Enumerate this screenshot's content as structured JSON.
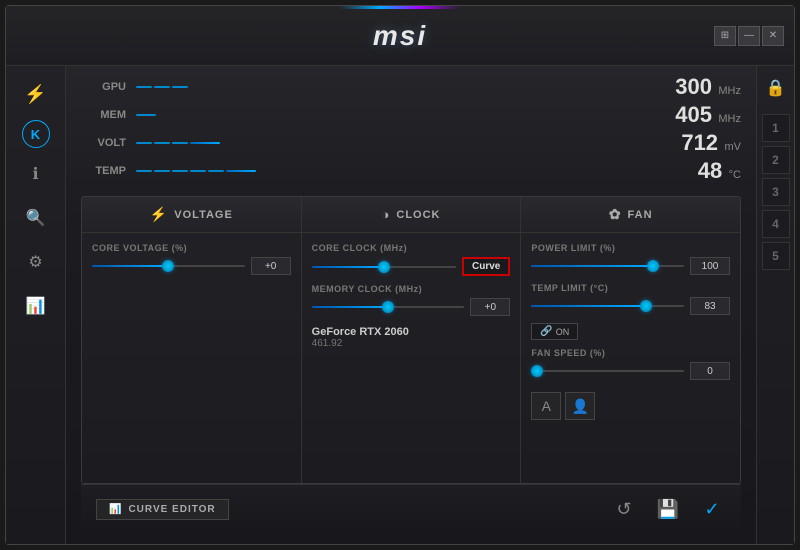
{
  "window": {
    "title": "msi",
    "controls": {
      "win_icon": "⊞",
      "min_label": "—",
      "close_label": "✕"
    }
  },
  "monitoring": {
    "rows": [
      {
        "label": "GPU",
        "value": "300",
        "unit": "MHz",
        "fill_pct": 15
      },
      {
        "label": "MEM",
        "value": "405",
        "unit": "MHz",
        "fill_pct": 20
      },
      {
        "label": "VOLT",
        "value": "712",
        "unit": "mV",
        "fill_pct": 45
      },
      {
        "label": "TEMP",
        "value": "48",
        "unit": "°C",
        "fill_pct": 55
      }
    ]
  },
  "panels": {
    "voltage": {
      "header": "VOLTAGE",
      "icon": "⚡",
      "core_voltage_label": "CORE VOLTAGE (%)",
      "core_voltage_value": "+0"
    },
    "clock": {
      "header": "CLOCK",
      "icon": "◑",
      "core_clock_label": "CORE CLOCK (MHz)",
      "core_clock_btn": "Curve",
      "memory_clock_label": "MEMORY CLOCK (MHz)",
      "memory_clock_value": "+0"
    },
    "fan": {
      "header": "FAN",
      "icon": "❄",
      "power_limit_label": "POWER LIMIT (%)",
      "power_limit_value": "100",
      "temp_limit_label": "TEMP LIMIT (°C)",
      "temp_limit_value": "83",
      "on_label": "ON",
      "fan_speed_label": "FAN SPEED (%)",
      "fan_speed_value": "0"
    }
  },
  "gpu_info": {
    "name": "GeForce RTX 2060",
    "driver": "461.92"
  },
  "bottom": {
    "curve_editor_label": "CURVE EDITOR",
    "reset_icon": "↺",
    "save_icon": "💾",
    "apply_icon": "✓"
  },
  "sidebar_left": {
    "icons": [
      "⚙",
      "K",
      "ℹ",
      "🔍",
      "⚙",
      "📊"
    ]
  },
  "sidebar_right": {
    "lock_icon": "🔒",
    "profiles": [
      "1",
      "2",
      "3",
      "4",
      "5"
    ]
  }
}
